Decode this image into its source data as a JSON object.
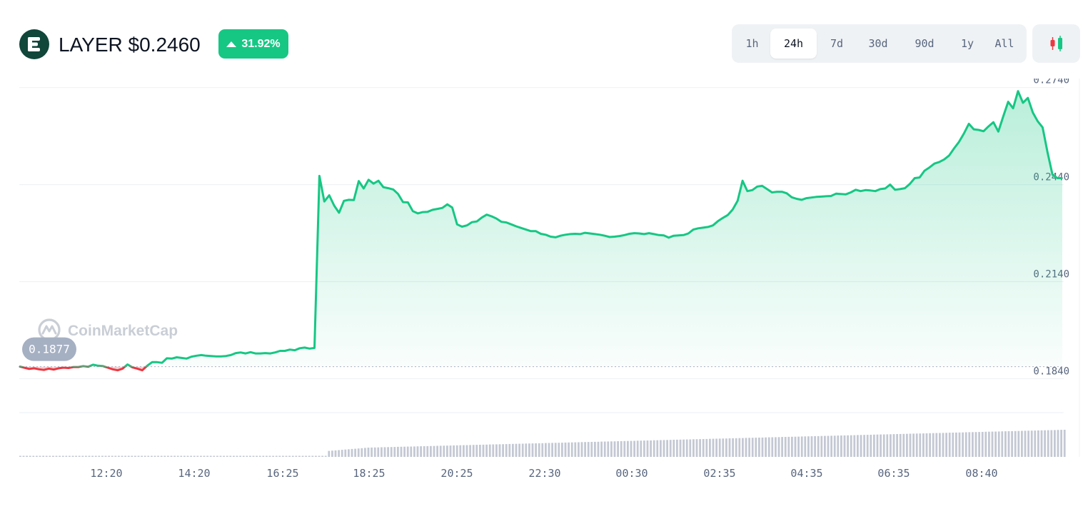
{
  "header": {
    "title": "LAYER $0.2460",
    "change_pct": "31.92%",
    "change_direction": "up"
  },
  "time_ranges": [
    {
      "label": "1h",
      "active": false
    },
    {
      "label": "24h",
      "active": true
    },
    {
      "label": "7d",
      "active": false
    },
    {
      "label": "30d",
      "active": false
    },
    {
      "label": "90d",
      "active": false
    },
    {
      "label": "1y",
      "active": false
    },
    {
      "label": "All",
      "active": false
    }
  ],
  "watermark": "CoinMarketCap",
  "colors": {
    "up": "#16c784",
    "down": "#ea3943",
    "logo_bg": "#11463a",
    "grid": "#eff2f5",
    "text_muted": "#58667e"
  },
  "chart_data": {
    "type": "line",
    "title": "",
    "xlabel": "",
    "ylabel": "",
    "y_ticks": [
      0.184,
      0.214,
      0.244,
      0.274
    ],
    "y_tick_labels": [
      "0.1840",
      "0.2140",
      "0.2440",
      "0.2740"
    ],
    "ylim": [
      0.1735,
      0.2768
    ],
    "baseline": {
      "value": 0.1877,
      "label": "0.1877"
    },
    "x_ticks": [
      "12:20",
      "14:20",
      "16:25",
      "18:25",
      "20:25",
      "22:30",
      "00:30",
      "02:35",
      "04:35",
      "06:35",
      "08:40"
    ],
    "grid": true,
    "series": [
      {
        "values": [
          0.1878,
          0.1874,
          0.187,
          0.1872,
          0.1869,
          0.1867,
          0.1871,
          0.1868,
          0.1872,
          0.1874,
          0.1873,
          0.1876,
          0.1876,
          0.1879,
          0.1877,
          0.1883,
          0.188,
          0.1879,
          0.1874,
          0.1869,
          0.1866,
          0.1871,
          0.1884,
          0.1875,
          0.1871,
          0.1866,
          0.188,
          0.1891,
          0.1891,
          0.1889,
          0.1903,
          0.1902,
          0.1906,
          0.1904,
          0.1902,
          0.1908,
          0.1911,
          0.1913,
          0.1911,
          0.191,
          0.1909,
          0.1909,
          0.191,
          0.1913,
          0.1919,
          0.1921,
          0.1918,
          0.1922,
          0.1918,
          0.1918,
          0.1919,
          0.1918,
          0.1921,
          0.1926,
          0.1926,
          0.193,
          0.1928,
          0.1934,
          0.1936,
          0.1933,
          0.1935,
          0.2467,
          0.2388,
          0.2407,
          0.2375,
          0.2353,
          0.239,
          0.2393,
          0.2392,
          0.2451,
          0.2428,
          0.2455,
          0.2443,
          0.2452,
          0.2432,
          0.2429,
          0.2425,
          0.2411,
          0.2386,
          0.2385,
          0.2358,
          0.2351,
          0.2355,
          0.2356,
          0.2362,
          0.2365,
          0.2368,
          0.2379,
          0.2369,
          0.2317,
          0.231,
          0.2314,
          0.2324,
          0.2326,
          0.2338,
          0.2347,
          0.2342,
          0.2335,
          0.2325,
          0.2323,
          0.2317,
          0.2311,
          0.2306,
          0.2301,
          0.2296,
          0.2296,
          0.2288,
          0.2285,
          0.2279,
          0.2277,
          0.2282,
          0.2285,
          0.2287,
          0.2288,
          0.2287,
          0.2291,
          0.2289,
          0.2287,
          0.2285,
          0.2282,
          0.2278,
          0.2279,
          0.2281,
          0.2284,
          0.2288,
          0.229,
          0.2289,
          0.2287,
          0.229,
          0.2287,
          0.2284,
          0.2283,
          0.2276,
          0.2282,
          0.2283,
          0.2284,
          0.2289,
          0.2301,
          0.2305,
          0.2307,
          0.2309,
          0.2314,
          0.2327,
          0.2337,
          0.2346,
          0.2363,
          0.239,
          0.2452,
          0.242,
          0.2423,
          0.2434,
          0.2436,
          0.2426,
          0.2416,
          0.2418,
          0.2418,
          0.2413,
          0.2401,
          0.2396,
          0.2393,
          0.2398,
          0.24,
          0.2402,
          0.2403,
          0.2404,
          0.2405,
          0.2412,
          0.2411,
          0.241,
          0.2416,
          0.2424,
          0.242,
          0.2423,
          0.2422,
          0.242,
          0.2426,
          0.2428,
          0.244,
          0.2424,
          0.2426,
          0.2429,
          0.2442,
          0.246,
          0.2462,
          0.2483,
          0.2493,
          0.2505,
          0.251,
          0.2518,
          0.253,
          0.2552,
          0.2572,
          0.2598,
          0.2628,
          0.2611,
          0.2609,
          0.2605,
          0.262,
          0.2633,
          0.2604,
          0.2651,
          0.2696,
          0.2676,
          0.2729,
          0.2693,
          0.2708,
          0.2663,
          0.2636,
          0.2617,
          0.254,
          0.2471,
          0.246,
          0.246
        ]
      }
    ]
  }
}
